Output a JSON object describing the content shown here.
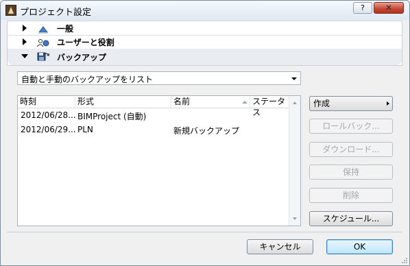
{
  "window": {
    "title": "プロジェクト設定"
  },
  "titlebar": {
    "help_label": "?",
    "close_label": "✕"
  },
  "sections": [
    {
      "label": "一般",
      "expanded": false,
      "icon": "general-icon"
    },
    {
      "label": "ユーザーと役割",
      "expanded": false,
      "icon": "users-icon"
    },
    {
      "label": "バックアップ",
      "expanded": true,
      "icon": "backup-icon"
    }
  ],
  "filter": {
    "selected": "自動と手動のバックアップをリスト"
  },
  "list": {
    "columns": [
      "時刻",
      "形式",
      "名前",
      "ステータス"
    ],
    "rows": [
      {
        "time": "2012/06/28...",
        "format": "BIMProject (自動)",
        "name": "",
        "status": ""
      },
      {
        "time": "2012/06/29...",
        "format": "PLN",
        "name": "新規バックアップ",
        "status": ""
      }
    ]
  },
  "actions": {
    "create": "作成",
    "rollback": "ロールバック...",
    "download": "ダウンロード...",
    "keep": "保持",
    "delete": "削除",
    "schedule": "スケジュール..."
  },
  "footer": {
    "cancel": "キャンセル",
    "ok": "OK"
  }
}
